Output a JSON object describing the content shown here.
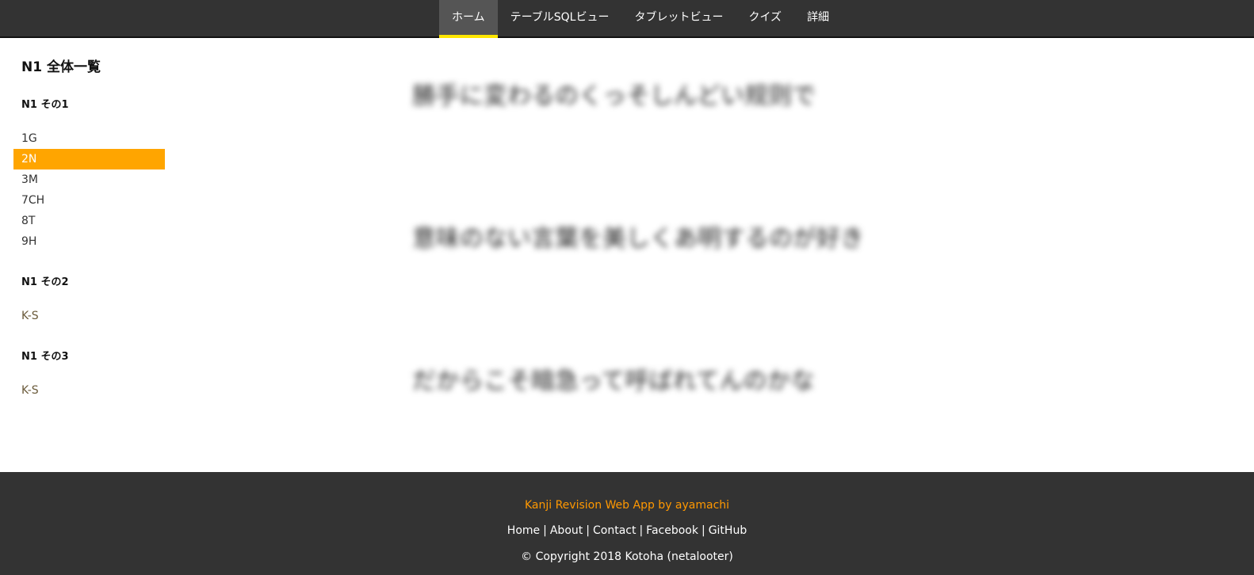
{
  "nav": {
    "items": [
      "ホーム",
      "テーブルSQLビュー",
      "タブレットビュー",
      "クイズ",
      "詳細"
    ],
    "active_index": 0,
    "accent": "#ffe600"
  },
  "sidebar": {
    "title": "N1 全体一覧",
    "sections": [
      {
        "label": "N1 その1",
        "items": [
          "1G",
          "2N",
          "3M",
          "7CH",
          "8T",
          "9H"
        ]
      },
      {
        "label": "N1 その2",
        "items": [
          "K-S"
        ]
      },
      {
        "label": "N1 その3",
        "items": [
          "K-S"
        ]
      }
    ],
    "active_item": "2N",
    "active_color": "#ffa500"
  },
  "main": {
    "lines": [
      "勝手に変わるのくっそしんどい规则で",
      "意味のない言葉を美しくあ明するのが好き",
      "だからこそ暗急って呼ばれてんのかな"
    ]
  },
  "footer": {
    "credit": "Kanji Revision Web App by ayamachi",
    "credit_color": "#ff9800",
    "links": [
      "Home",
      "About",
      "Contact",
      "Facebook",
      "GitHub"
    ],
    "separator": "|",
    "copyright": "© Copyright 2018 Kotoha (netalooter)"
  }
}
